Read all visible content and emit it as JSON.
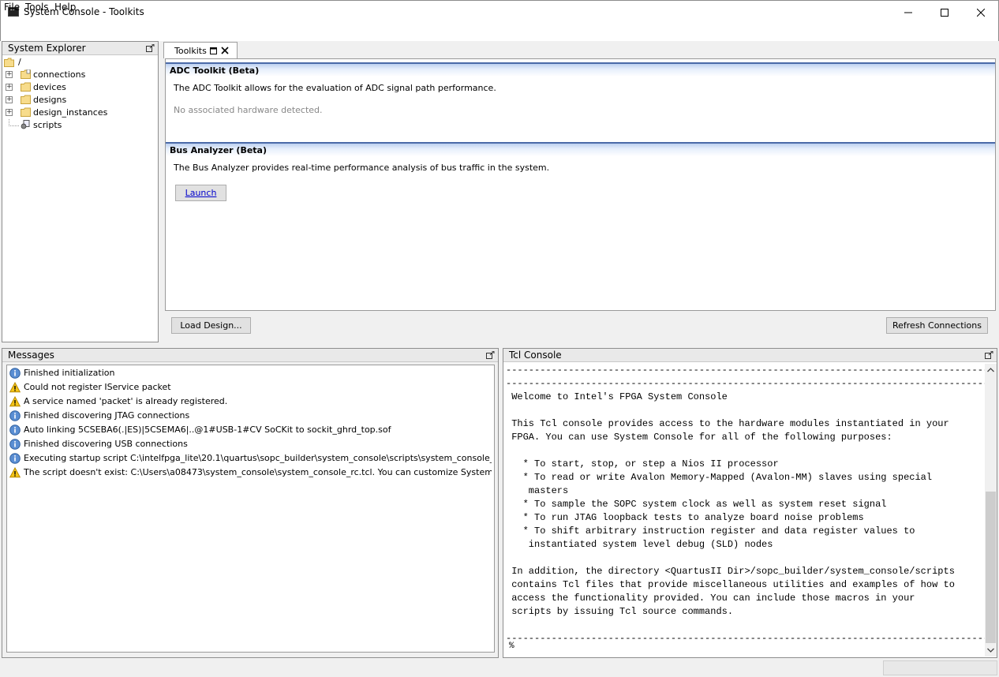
{
  "window": {
    "title": "System Console - Toolkits"
  },
  "menu": {
    "file": "File",
    "tools": "Tools",
    "help": "Help"
  },
  "system_explorer": {
    "title": "System Explorer",
    "root": "/",
    "items": [
      {
        "label": "connections",
        "icon": "folder-icon"
      },
      {
        "label": "devices",
        "icon": "folder-icon"
      },
      {
        "label": "designs",
        "icon": "folder-icon"
      },
      {
        "label": "design_instances",
        "icon": "folder-icon"
      },
      {
        "label": "scripts",
        "icon": "script-icon"
      }
    ]
  },
  "toolkits": {
    "tab_label": "Toolkits",
    "sections": [
      {
        "title": "ADC Toolkit (Beta)",
        "description": "The ADC Toolkit allows for the evaluation of ADC signal path performance.",
        "status": "No associated hardware detected."
      },
      {
        "title": "Bus Analyzer (Beta)",
        "description": "The Bus Analyzer provides real-time performance analysis of bus traffic in the system.",
        "button": "Launch"
      }
    ],
    "load_design_label": "Load Design...",
    "refresh_label": "Refresh Connections"
  },
  "messages": {
    "title": "Messages",
    "items": [
      {
        "type": "info",
        "text": "Finished initialization"
      },
      {
        "type": "warning",
        "text": "Could not register IService packet"
      },
      {
        "type": "warning",
        "text": "A service named 'packet' is already registered."
      },
      {
        "type": "info",
        "text": "Finished discovering JTAG connections"
      },
      {
        "type": "info",
        "text": "Auto linking 5CSEBA6(.|ES)|5CSEMA6|..@1#USB-1#CV SoCKit to sockit_ghrd_top.sof"
      },
      {
        "type": "info",
        "text": "Finished discovering USB connections"
      },
      {
        "type": "info",
        "text": "Executing startup script C:\\intelfpga_lite\\20.1\\quartus\\sopc_builder\\system_console\\scripts\\system_console_rc.tcl"
      },
      {
        "type": "warning",
        "text": "The script doesn't exist: C:\\Users\\a08473\\system_console\\system_console_rc.tcl. You can customize System Console by ..."
      }
    ]
  },
  "tcl_console": {
    "title": "Tcl Console",
    "text": "------------------------------------------------------------------------------------------------------------\n------------------------------------------------------------------------------------------------------------\n Welcome to Intel's FPGA System Console\n\n This Tcl console provides access to the hardware modules instantiated in your\n FPGA. You can use System Console for all of the following purposes:\n\n   * To start, stop, or step a Nios II processor\n   * To read or write Avalon Memory-Mapped (Avalon-MM) slaves using special\n    masters\n   * To sample the SOPC system clock as well as system reset signal\n   * To run JTAG loopback tests to analyze board noise problems\n   * To shift arbitrary instruction register and data register values to\n    instantiated system level debug (SLD) nodes\n\n In addition, the directory <QuartusII Dir>/sopc_builder/system_console/scripts\n contains Tcl files that provide miscellaneous utilities and examples of how to\n access the functionality provided. You can include those macros in your\n scripts by issuing Tcl source commands.\n\n------------------------------------------------------------------------------------------------------------",
    "prompt": "%"
  }
}
